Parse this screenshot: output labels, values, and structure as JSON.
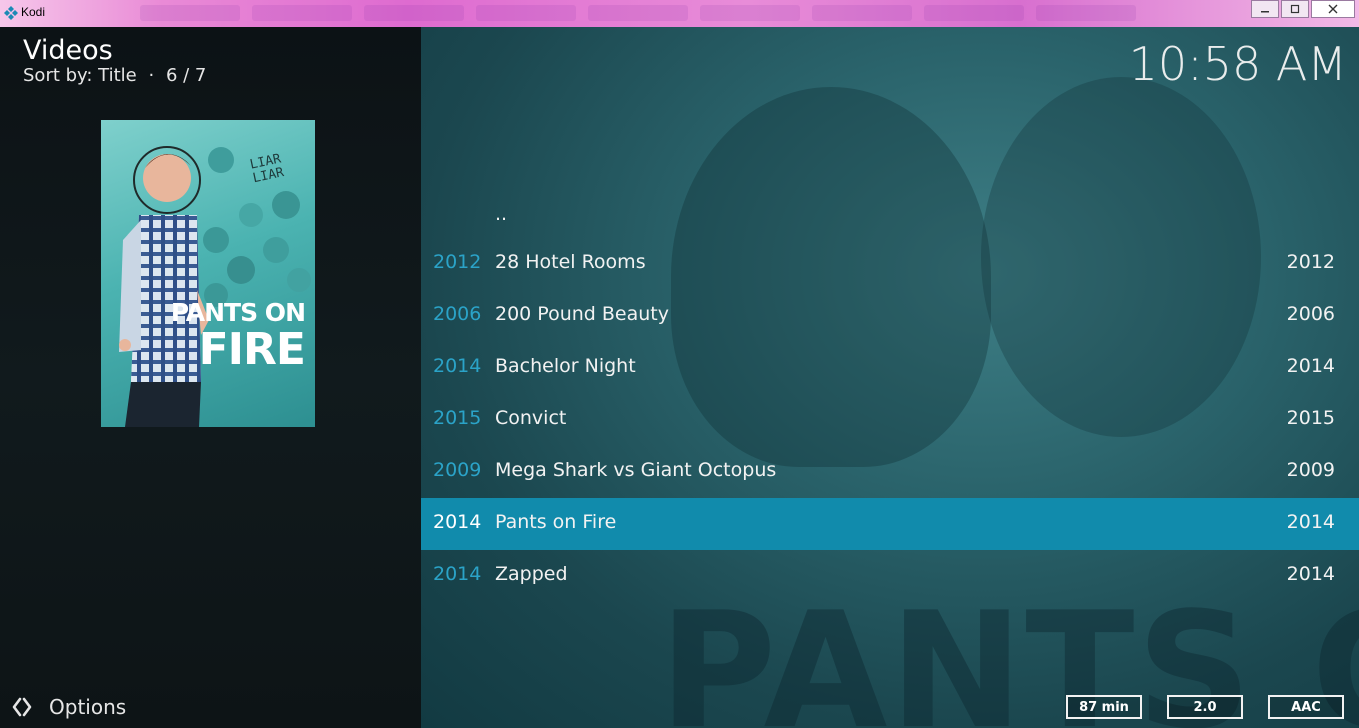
{
  "window": {
    "title": "Kodi"
  },
  "header": {
    "title": "Videos",
    "sort_label": "Sort by: Title",
    "separator": "·",
    "position": "6 / 7"
  },
  "clock": "10:58 AM",
  "poster": {
    "line1": "PANTS ON",
    "line2": "FIRE",
    "scribble": "LIAR LIAR"
  },
  "options_label": "Options",
  "list": {
    "parent": "..",
    "items": [
      {
        "year_left": "2012",
        "title": "28 Hotel Rooms",
        "year_right": "2012",
        "selected": false
      },
      {
        "year_left": "2006",
        "title": "200 Pound Beauty",
        "year_right": "2006",
        "selected": false
      },
      {
        "year_left": "2014",
        "title": "Bachelor Night",
        "year_right": "2014",
        "selected": false
      },
      {
        "year_left": "2015",
        "title": "Convict",
        "year_right": "2015",
        "selected": false
      },
      {
        "year_left": "2009",
        "title": "Mega Shark vs Giant Octopus",
        "year_right": "2009",
        "selected": false
      },
      {
        "year_left": "2014",
        "title": "Pants on Fire",
        "year_right": "2014",
        "selected": true
      },
      {
        "year_left": "2014",
        "title": "Zapped",
        "year_right": "2014",
        "selected": false
      }
    ]
  },
  "background_text": "PANTS ON",
  "badges": {
    "runtime": "87 min",
    "audio_channels": "2.0",
    "audio_codec": "AAC"
  },
  "colors": {
    "accent": "#118bac",
    "year_accent": "#2ba3c8"
  }
}
